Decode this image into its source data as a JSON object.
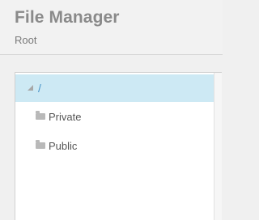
{
  "header": {
    "title": "File Manager",
    "subtitle": "Root"
  },
  "tree": {
    "root": {
      "label": "/",
      "expanded": true,
      "selected": true,
      "icon": "triangle-expanded-icon"
    },
    "children": [
      {
        "label": "Private",
        "icon": "folder-icon"
      },
      {
        "label": "Public",
        "icon": "folder-icon"
      }
    ]
  },
  "colors": {
    "selection_bg": "#cde9f4",
    "root_label": "#4a95c9",
    "folder": "#b9b9b9",
    "title": "#8a8a8a"
  }
}
